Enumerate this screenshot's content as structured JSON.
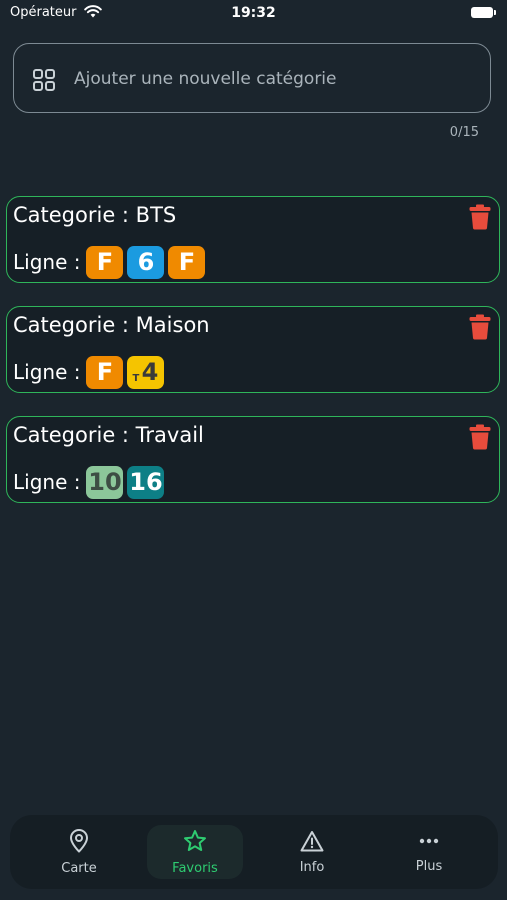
{
  "status_bar": {
    "carrier": "Opérateur",
    "time": "19:32"
  },
  "add_category": {
    "placeholder": "Ajouter une nouvelle catégorie",
    "value": "",
    "counter": "0/15"
  },
  "categories": [
    {
      "title": "Categorie : BTS",
      "line_label": "Ligne :",
      "lines": [
        {
          "label": "F",
          "bg": "#f08a00",
          "fg": "#ffffff"
        },
        {
          "label": "6",
          "bg": "#1b9be0",
          "fg": "#ffffff"
        },
        {
          "label": "F",
          "bg": "#f08a00",
          "fg": "#ffffff"
        }
      ]
    },
    {
      "title": "Categorie : Maison",
      "line_label": "Ligne :",
      "lines": [
        {
          "label": "F",
          "bg": "#f08a00",
          "fg": "#ffffff"
        },
        {
          "label": "4",
          "prefix": "T",
          "bg": "#f5c400",
          "fg": "#3a3a3a"
        }
      ]
    },
    {
      "title": "Categorie : Travail",
      "line_label": "Ligne :",
      "lines": [
        {
          "label": "10",
          "bg": "#8cc79a",
          "fg": "#3d4d44"
        },
        {
          "label": "16",
          "bg": "#0d7f86",
          "fg": "#ffffff"
        }
      ]
    }
  ],
  "tabs": [
    {
      "label": "Carte",
      "icon": "map-pin-icon",
      "active": false
    },
    {
      "label": "Favoris",
      "icon": "star-icon",
      "active": true
    },
    {
      "label": "Info",
      "icon": "warning-icon",
      "active": false
    },
    {
      "label": "Plus",
      "icon": "more-dots-icon",
      "active": false
    }
  ],
  "colors": {
    "background": "#1b252d",
    "accent": "#2ecc71",
    "card_border": "#2fb55a",
    "delete": "#e74c3c"
  }
}
